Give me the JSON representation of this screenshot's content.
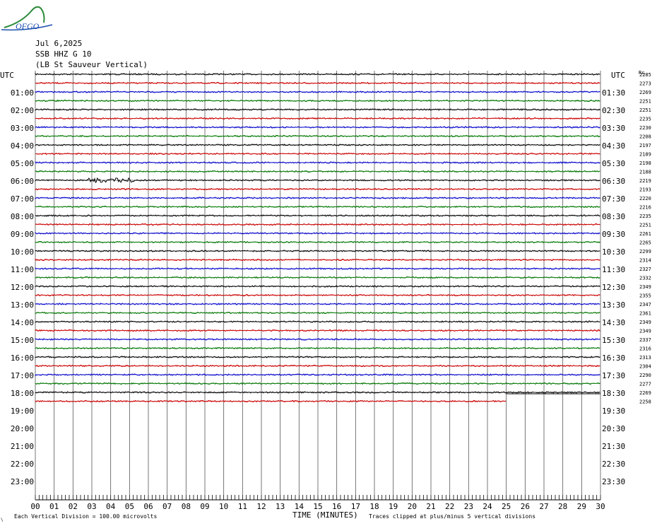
{
  "logo": {
    "text": "OFGO"
  },
  "header": {
    "date": "Jul 6,2025",
    "station": "SSB HHZ G 10",
    "location": "(LB St Sauveur Vertical)"
  },
  "axis": {
    "utc_left": "UTC",
    "utc_right": "UTC",
    "right_col_label": "Rc",
    "xlabel": "TIME (MINUTES)"
  },
  "footer": {
    "scale_note": "Each Vertical Division =  100.00 microvolts",
    "clip_note": "Traces clipped at plus/minus 5 vertical divisions"
  },
  "chart_data": {
    "type": "line",
    "title": "SSB HHZ G 10",
    "xlabel": "TIME (MINUTES)",
    "ylabel": "UTC",
    "xlim": [
      0,
      30
    ],
    "x_ticks": [
      "00",
      "01",
      "02",
      "03",
      "04",
      "05",
      "06",
      "07",
      "08",
      "09",
      "10",
      "11",
      "12",
      "13",
      "14",
      "15",
      "16",
      "17",
      "18",
      "19",
      "20",
      "21",
      "22",
      "23",
      "24",
      "25",
      "26",
      "27",
      "28",
      "29",
      "30"
    ],
    "left_hour_labels": [
      "UTC",
      "01:00",
      "02:00",
      "03:00",
      "04:00",
      "05:00",
      "06:00",
      "07:00",
      "08:00",
      "09:00",
      "10:00",
      "11:00",
      "12:00",
      "13:00",
      "14:00",
      "15:00",
      "16:00",
      "17:00",
      "18:00",
      "19:00",
      "20:00",
      "21:00",
      "22:00",
      "23:00"
    ],
    "right_hour_labels": [
      "UTC",
      "01:30",
      "02:30",
      "03:30",
      "04:30",
      "05:30",
      "06:30",
      "07:30",
      "08:30",
      "09:30",
      "10:30",
      "11:30",
      "12:30",
      "13:30",
      "14:30",
      "15:30",
      "16:30",
      "17:30",
      "18:30",
      "19:30",
      "20:30",
      "21:30",
      "22:30",
      "23:30"
    ],
    "trace_colors": [
      "#000000",
      "#cc0000",
      "#0000cc",
      "#007700"
    ],
    "trace_values": [
      2285,
      2273,
      2269,
      2251,
      2251,
      2235,
      2230,
      2208,
      2197,
      2189,
      2198,
      2188,
      2219,
      2193,
      2220,
      2216,
      2235,
      2251,
      2261,
      2265,
      2299,
      2314,
      2327,
      2332,
      2349,
      2355,
      2347,
      2361,
      2349,
      2349,
      2337,
      2316,
      2313,
      2304,
      2290,
      2277,
      2269,
      2258
    ],
    "last_trace_end_minute": 25,
    "active_event_trace": 12
  }
}
